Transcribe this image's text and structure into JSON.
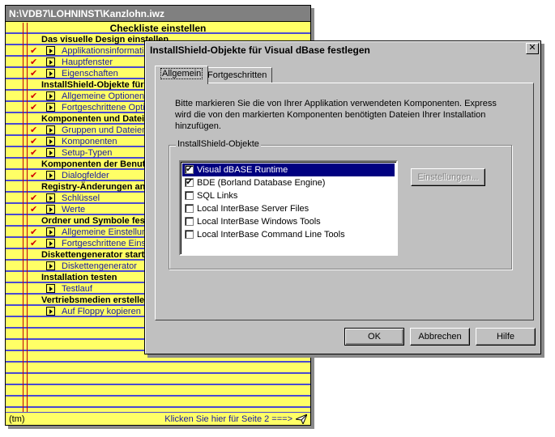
{
  "checklist": {
    "title": "N:\\VDB7\\LOHNINST\\Kanzlohn.iwz",
    "heading": "Checkliste einstellen",
    "rows": [
      {
        "type": "section",
        "text": "Das visuelle Design einstellen"
      },
      {
        "type": "item",
        "checked": true,
        "text": "Applikationsinformation"
      },
      {
        "type": "item",
        "checked": true,
        "text": "Hauptfenster"
      },
      {
        "type": "item",
        "checked": true,
        "text": "Eigenschaften"
      },
      {
        "type": "section",
        "text": "InstallShield-Objekte für Visual dBase festlegen"
      },
      {
        "type": "item",
        "checked": true,
        "text": "Allgemeine Optionen"
      },
      {
        "type": "item",
        "checked": true,
        "text": "Fortgeschrittene Optionen"
      },
      {
        "type": "section",
        "text": "Komponenten und Dateigruppen festlegen"
      },
      {
        "type": "item",
        "checked": true,
        "text": "Gruppen und Dateien"
      },
      {
        "type": "item",
        "checked": true,
        "text": "Komponenten"
      },
      {
        "type": "item",
        "checked": true,
        "text": "Setup-Typen"
      },
      {
        "type": "section",
        "text": "Komponenten der Benutzeroberfläche"
      },
      {
        "type": "item",
        "checked": true,
        "text": "Dialogfelder"
      },
      {
        "type": "section",
        "text": "Registry-Änderungen angeben"
      },
      {
        "type": "item",
        "checked": true,
        "text": "Schlüssel"
      },
      {
        "type": "item",
        "checked": true,
        "text": "Werte"
      },
      {
        "type": "section",
        "text": "Ordner und Symbole festlegen"
      },
      {
        "type": "item",
        "checked": true,
        "text": "Allgemeine Einstellungen"
      },
      {
        "type": "item",
        "checked": true,
        "text": "Fortgeschrittene Einstellungen"
      },
      {
        "type": "section",
        "text": "Diskettengenerator starten"
      },
      {
        "type": "item",
        "checked": false,
        "text": "Diskettengenerator"
      },
      {
        "type": "section",
        "text": "Installation testen"
      },
      {
        "type": "item",
        "checked": false,
        "text": "Testlauf"
      },
      {
        "type": "section",
        "text": "Vertriebsmedien erstellen"
      },
      {
        "type": "item",
        "checked": false,
        "text": "Auf Floppy kopieren"
      }
    ],
    "footer_left": "(tm)",
    "footer_next": "Klicken Sie hier für Seite 2 ===>",
    "check_glyph": "✔"
  },
  "dialog": {
    "title": "InstallShield-Objekte für Visual dBase festlegen",
    "close_glyph": "✕",
    "tabs": [
      "Allgemein",
      "Fortgeschritten"
    ],
    "description": "Bitte markieren Sie die von Ihrer Applikation verwendeten Komponenten. Express wird die von den markierten Komponenten benötigten Dateien Ihrer Installation hinzufügen.",
    "group_label": "InstallShield-Objekte",
    "items": [
      {
        "label": "Visual dBASE Runtime",
        "checked": true,
        "selected": true
      },
      {
        "label": "BDE (Borland Database Engine)",
        "checked": true,
        "selected": false
      },
      {
        "label": "SQL Links",
        "checked": false,
        "selected": false
      },
      {
        "label": "Local InterBase Server Files",
        "checked": false,
        "selected": false
      },
      {
        "label": "Local InterBase Windows Tools",
        "checked": false,
        "selected": false
      },
      {
        "label": "Local InterBase Command Line Tools",
        "checked": false,
        "selected": false
      }
    ],
    "settings_button": "Einstellungen...",
    "ok_button": "OK",
    "cancel_button": "Abbrechen",
    "help_button": "Hilfe"
  },
  "colors": {
    "paper": "#ffff66",
    "rule_lines": "#4a4ad0",
    "margin_lines": "#c00000",
    "link_text": "#1a1aa0",
    "selection": "#000080",
    "dialog_face": "#c0c0c0"
  }
}
